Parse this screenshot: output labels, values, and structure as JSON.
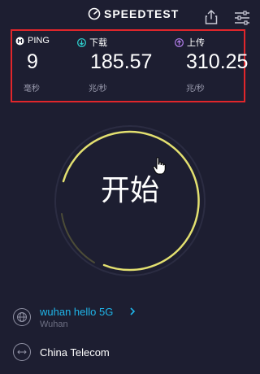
{
  "header": {
    "logo_text": "SPEEDTEST",
    "logo_icon": "speedometer-icon",
    "share_icon": "share-icon",
    "settings_icon": "settings-sliders-icon"
  },
  "stats": {
    "ping": {
      "label": "PING",
      "value": "9",
      "unit": "毫秒",
      "icon": "ping-icon"
    },
    "download": {
      "label": "下载",
      "value": "185.57",
      "unit": "兆/秒",
      "icon": "download-arrow-icon"
    },
    "upload": {
      "label": "上传",
      "value": "310.25",
      "unit": "兆/秒",
      "icon": "upload-arrow-icon"
    }
  },
  "start_button": {
    "label": "开始"
  },
  "network": {
    "wifi_name": "wuhan hello 5G",
    "location": "Wuhan",
    "isp": "China Telecom"
  },
  "colors": {
    "background": "#1d1e31",
    "highlight_border": "#e0262b",
    "gauge_ring": "#e3e070",
    "download_accent": "#2ed3d0",
    "upload_accent": "#b07ce8",
    "link": "#1fb5e9"
  }
}
